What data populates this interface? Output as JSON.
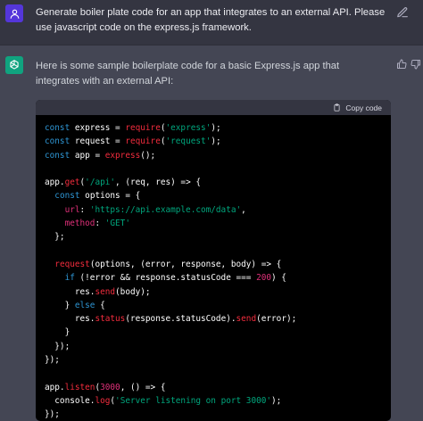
{
  "user_message": {
    "text": "Generate boiler plate code for an app that integrates to an external API. Please use javascript code on the express.js framework."
  },
  "assistant_message": {
    "text": "Here is some sample boilerplate code for a basic Express.js app that integrates with an external API:",
    "code_block": {
      "copy_label": "Copy code",
      "lines": [
        [
          [
            "kw",
            "const"
          ],
          [
            "pl",
            " express = "
          ],
          [
            "fn",
            "require"
          ],
          [
            "pl",
            "("
          ],
          [
            "str",
            "'express'"
          ],
          [
            "pl",
            ");"
          ]
        ],
        [
          [
            "kw",
            "const"
          ],
          [
            "pl",
            " request = "
          ],
          [
            "fn",
            "require"
          ],
          [
            "pl",
            "("
          ],
          [
            "str",
            "'request'"
          ],
          [
            "pl",
            ");"
          ]
        ],
        [
          [
            "kw",
            "const"
          ],
          [
            "pl",
            " app = "
          ],
          [
            "fn",
            "express"
          ],
          [
            "pl",
            "();"
          ]
        ],
        [],
        [
          [
            "pl",
            "app."
          ],
          [
            "fn",
            "get"
          ],
          [
            "pl",
            "("
          ],
          [
            "str",
            "'/api'"
          ],
          [
            "pl",
            ", (req, res) => {"
          ]
        ],
        [
          [
            "pl",
            "  "
          ],
          [
            "kw",
            "const"
          ],
          [
            "pl",
            " options = {"
          ]
        ],
        [
          [
            "pl",
            "    "
          ],
          [
            "prop",
            "url"
          ],
          [
            "pl",
            ": "
          ],
          [
            "str",
            "'https://api.example.com/data'"
          ],
          [
            "pl",
            ","
          ]
        ],
        [
          [
            "pl",
            "    "
          ],
          [
            "prop",
            "method"
          ],
          [
            "pl",
            ": "
          ],
          [
            "str",
            "'GET'"
          ]
        ],
        [
          [
            "pl",
            "  };"
          ]
        ],
        [],
        [
          [
            "pl",
            "  "
          ],
          [
            "fn",
            "request"
          ],
          [
            "pl",
            "(options, (error, response, body) => {"
          ]
        ],
        [
          [
            "pl",
            "    "
          ],
          [
            "kw",
            "if"
          ],
          [
            "pl",
            " (!error && response.statusCode === "
          ],
          [
            "num",
            "200"
          ],
          [
            "pl",
            ") {"
          ]
        ],
        [
          [
            "pl",
            "      res."
          ],
          [
            "fn",
            "send"
          ],
          [
            "pl",
            "(body);"
          ]
        ],
        [
          [
            "pl",
            "    } "
          ],
          [
            "kw",
            "else"
          ],
          [
            "pl",
            " {"
          ]
        ],
        [
          [
            "pl",
            "      res."
          ],
          [
            "fn",
            "status"
          ],
          [
            "pl",
            "(response.statusCode)."
          ],
          [
            "fn",
            "send"
          ],
          [
            "pl",
            "(error);"
          ]
        ],
        [
          [
            "pl",
            "    }"
          ]
        ],
        [
          [
            "pl",
            "  });"
          ]
        ],
        [
          [
            "pl",
            "});"
          ]
        ],
        [],
        [
          [
            "pl",
            "app."
          ],
          [
            "fn",
            "listen"
          ],
          [
            "pl",
            "("
          ],
          [
            "num",
            "3000"
          ],
          [
            "pl",
            ", () => {"
          ]
        ],
        [
          [
            "pl",
            "  console."
          ],
          [
            "fn",
            "log"
          ],
          [
            "pl",
            "("
          ],
          [
            "str",
            "'Server listening on port 3000'"
          ],
          [
            "pl",
            ");"
          ]
        ],
        [
          [
            "pl",
            "});"
          ]
        ]
      ]
    }
  },
  "icons": {
    "user_avatar": "user-icon",
    "assistant_avatar": "openai-logo-icon",
    "edit": "edit-icon",
    "thumbs_up": "thumbs-up-icon",
    "thumbs_down": "thumbs-down-icon",
    "copy": "clipboard-icon"
  },
  "colors": {
    "user_background": "#343541",
    "assistant_background": "#444654",
    "user_avatar": "#5436da",
    "assistant_avatar": "#10a37f",
    "code_background": "#000000",
    "keyword": "#2e95d3",
    "function": "#f22c3d",
    "string": "#00a67d",
    "property": "#df3079"
  }
}
